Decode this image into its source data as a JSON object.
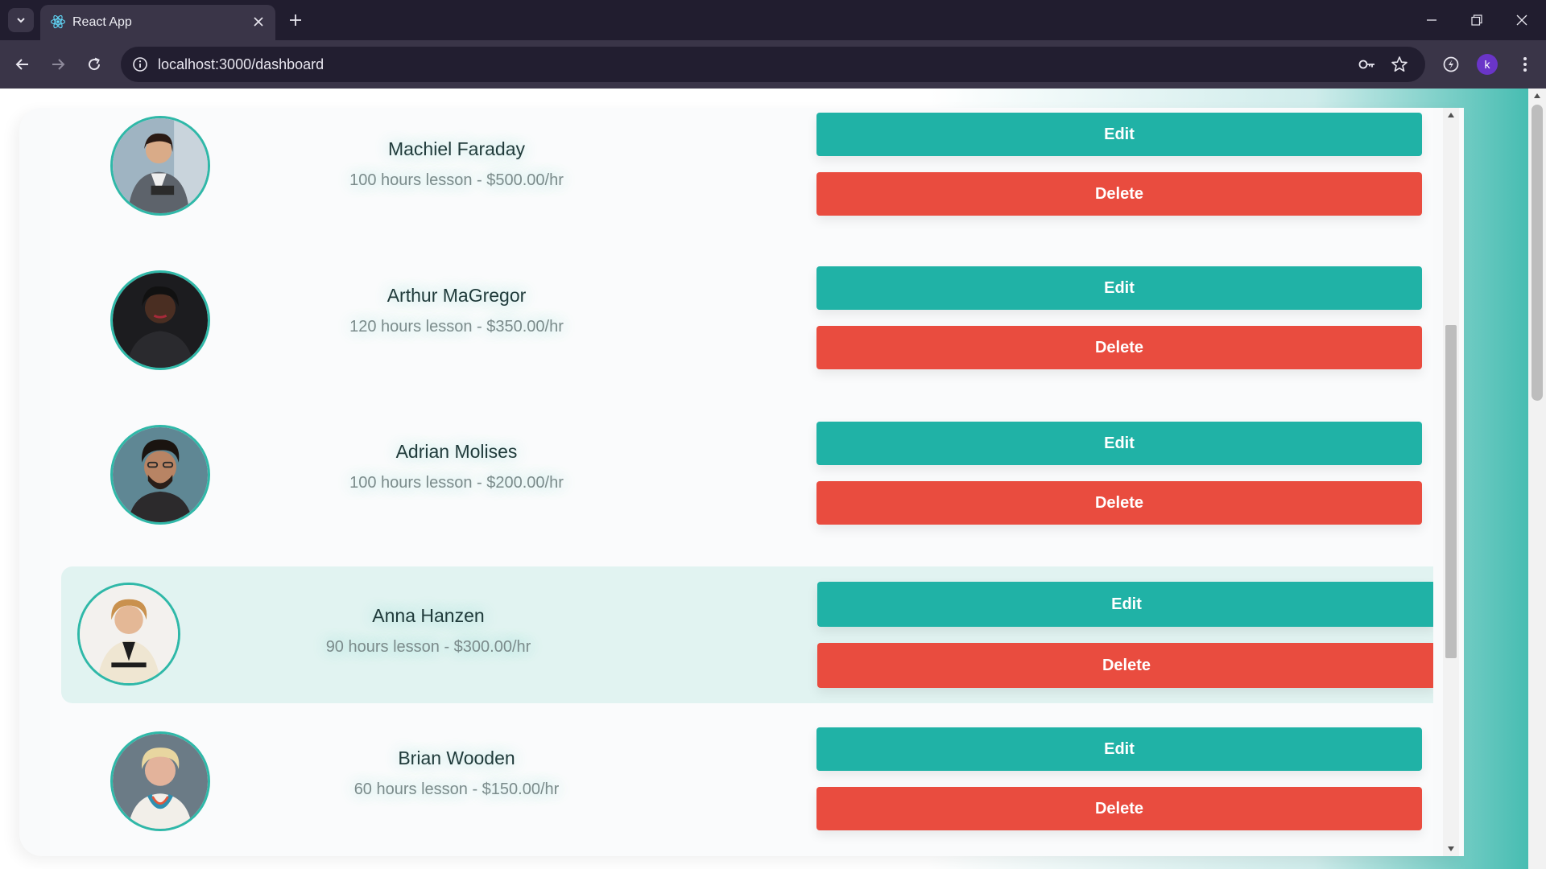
{
  "browser": {
    "tab_title": "React App",
    "url": "localhost:3000/dashboard",
    "profile_initial": "k"
  },
  "instructors": [
    {
      "name": "Machiel Faraday",
      "lesson": "100 hours lesson - $500.00/hr",
      "edit_label": "Edit",
      "delete_label": "Delete"
    },
    {
      "name": "Arthur MaGregor",
      "lesson": "120 hours lesson - $350.00/hr",
      "edit_label": "Edit",
      "delete_label": "Delete"
    },
    {
      "name": "Adrian Molises",
      "lesson": "100 hours lesson - $200.00/hr",
      "edit_label": "Edit",
      "delete_label": "Delete"
    },
    {
      "name": "Anna Hanzen",
      "lesson": "90 hours lesson - $300.00/hr",
      "edit_label": "Edit",
      "delete_label": "Delete"
    },
    {
      "name": "Brian Wooden",
      "lesson": "60 hours lesson - $150.00/hr",
      "edit_label": "Edit",
      "delete_label": "Delete"
    }
  ],
  "colors": {
    "accent": "#20b2a6",
    "danger": "#e94c3f",
    "highlight_row": "#e1f3f1"
  }
}
